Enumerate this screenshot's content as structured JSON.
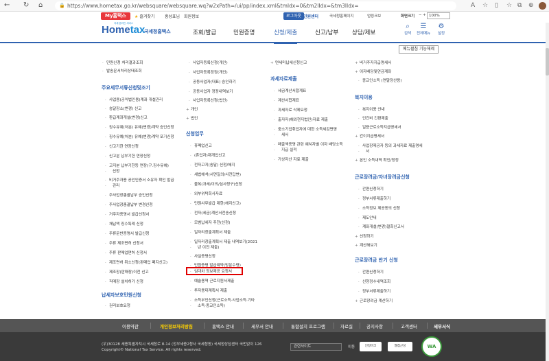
{
  "browser": {
    "url": "https://www.hometax.go.kr/websquare/websquare.wq?w2xPath=/ui/pp/index.xml&tmIdx=0&tm2lIdx=&tm3lIdx="
  },
  "utility": {
    "my_label": "My홈택스",
    "favorites": "즐겨찾기",
    "user_greeting": "홍성표님",
    "member_info": "회원정보",
    "login": "로그아웃",
    "help": "민원센터",
    "links": [
      "국세청홈페이지",
      "업링크보",
      "화면크기"
    ],
    "zoom_value": "100%"
  },
  "header": {
    "logo_main": "Home",
    "logo_tax": "tax",
    "logo_sub": "국세청홈택스",
    "logo_tag": "국세 온라인 서비스",
    "menu": [
      "조회/발급",
      "민원증명",
      "신청/제출",
      "신고/납부",
      "상담/제보"
    ],
    "icons": [
      {
        "icon": "search-icon",
        "label": "검색"
      },
      {
        "icon": "menu-icon",
        "label": "전체메뉴"
      },
      {
        "icon": "settings-icon",
        "label": "설정"
      }
    ]
  },
  "nav_edit": "메뉴펼침 기능해제",
  "col1": {
    "top_items": [
      "민원신청 처리결과조회",
      "발송문서처리상태조회"
    ],
    "sec_main": "주요세무서류신청및조기",
    "items": [
      "사업용(공익법인용)계좌 개설관리",
      "송달장소(변경) 신고",
      "환급계좌개설(변경)신고",
      "징수유예(처분) 유예(변경)계약 승인신청",
      "징수유예(처분) 유예(변경)계약 포기신청",
      "신고기한 연장신청",
      "신고분 납부기한 연장신청",
      "고지분 납부기한등 연장(구.징수유예)",
      "신청",
      "비거주자용 공인인증서 소유자 확인 발급",
      "관리",
      "주사업장총괄납부 승인신청",
      "주사업장총괄납부 변경신청",
      "거주자증명서 발급신청서",
      "채납액 징수특례 신청",
      "주류운반증명서 발급신청",
      "주류 제조면허 신청서",
      "주류 판매업면허 신청서",
      "제조면허 취소신청(판매업 폐지신고)",
      "제조장(판매장)이전 신고",
      "직매장 설치허가 신청"
    ],
    "sec_rights": "납세자보호민원신청",
    "rights_items": [
      "권리보호요청"
    ]
  },
  "col2": {
    "top_items": [
      "사업자등록신청(개인)",
      "사업자등록정정(개인)",
      "공동사업자(대표) 승인하기",
      "공동사업자 정정내역보기",
      "사업자등록신청(법인)"
    ],
    "plus_items": [
      "개인",
      "법인"
    ],
    "sec_apply": "신청업무",
    "items": [
      "휴폐업신고",
      "(휴업자)재개업신고",
      "전자고지(송달) 신청/해지",
      "세법해석(서면질의/사전답변)",
      "불복(과세/이의/심사청구)신청",
      "외부위탁회사자료",
      "민원사무발급 제한(해지신고)",
      "전자(세금)계산서전송신청",
      "모범납세자 추천(신청)",
      "일자리창출계획서 제출",
      "일자리창출계획서 제출 내역보기(2021",
      "년 이전 제출)",
      "사실증명신청",
      "민원증명 발급예약(방문수령)",
      "임대차 정보제공 요청서",
      "예술용역 근로지원서제출",
      "투자용대계획서 제출",
      "소득부인신청(근로소득·사업소득·기타",
      "소득·종교인소득)"
    ]
  },
  "col3": {
    "top_items": [
      "면세미납세신청신고"
    ],
    "sec_data": "과세자료제출",
    "items": [
      "세금계산서합계표",
      "계산서합계표",
      "과세자료 삭제요청",
      "출자자(해외현지법인)자료 제출",
      "중소기업취업자에 대한 소득세감면명",
      "세서",
      "매출액증명 관련 예치자별 이자 배당소득",
      "지급 실적",
      "가상자산 자료 제출"
    ]
  },
  "col4": {
    "top_items": [
      "비거주자지급명세서",
      "이자배당및연금계좌",
      "종교인소득 (연말정산용)"
    ],
    "sec_welfare": "복지이용",
    "welfare_items": [
      "복지이용 안내",
      "인건비 간편제출",
      "일용근로소득지급명세서",
      "간이지급명세서",
      "사업장제공자 등의 과세자료 제출명세",
      "서",
      "본인 소득내역 확인/청정"
    ],
    "sec_labor": "근로장려금/자녀장려금신청",
    "labor_items": [
      "간편신청하기",
      "정부서류제출하기",
      "소득정보 제공동의 신청",
      "제도안내",
      "계좌개설(변경)철회신고서",
      "신청하기",
      "계산해보기"
    ],
    "sec_half": "근로장려금 반기 신청",
    "half_items": [
      "간편신청하기",
      "신청정수내역조회",
      "정부서류제출하기",
      "근로장려금 계산하기"
    ]
  },
  "footer": {
    "links": [
      "이용약관",
      "개인정보처리방침",
      "홈택스 안내",
      "세무서 안내",
      "통합설치 프로그램",
      "자료실",
      "공지사항",
      "고객센터",
      "세무서식"
    ],
    "address_line1": "(우)30128 세종특별자치시 국세청로 8-14 (정부세종2청사 국세청동) 국세청상담센터 국번없이 126",
    "address_line2": "Copyright© National Tax Service. All rights reserved.",
    "related_site": "관련사이트",
    "move": "이동",
    "badge1": "인정마크",
    "badge2": "웹접근성",
    "wa_label": "WA"
  }
}
